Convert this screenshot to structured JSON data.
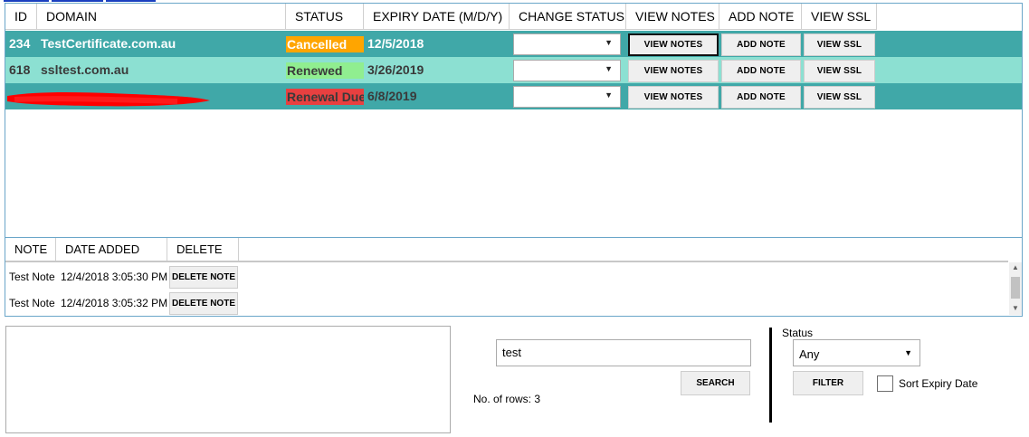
{
  "grid": {
    "columns": [
      "ID",
      "DOMAIN",
      "STATUS",
      "EXPIRY DATE (M/D/Y)",
      "CHANGE STATUS",
      "VIEW NOTES",
      "ADD NOTE",
      "VIEW SSL"
    ],
    "rows": [
      {
        "id": "234",
        "domain": "TestCertificate.com.au",
        "status": "Cancelled",
        "status_color": "#ffa500",
        "expiry": "12/5/2018",
        "row_color": "#40a8a8",
        "text_color": "#ffffff",
        "change_status": "",
        "view_notes": "VIEW NOTES",
        "add_note": "ADD NOTE",
        "view_ssl": "VIEW SSL"
      },
      {
        "id": "618",
        "domain": "ssltest.com.au",
        "status": "Renewed",
        "status_color": "#90ee90",
        "expiry": "3/26/2019",
        "row_color": "#8ce0d2",
        "text_color": "#3a3a3a",
        "change_status": "",
        "view_notes": "VIEW NOTES",
        "add_note": "ADD NOTE",
        "view_ssl": "VIEW SSL"
      },
      {
        "id": "",
        "domain": "",
        "status": "Renewal Due",
        "status_color": "#e84040",
        "expiry": "6/8/2019",
        "row_color": "#40a8a8",
        "text_color": "#3a3a3a",
        "change_status": "",
        "view_notes": "VIEW NOTES",
        "add_note": "ADD NOTE",
        "view_ssl": "VIEW SSL"
      }
    ]
  },
  "notes": {
    "columns": [
      "NOTE",
      "DATE ADDED",
      "DELETE"
    ],
    "rows": [
      {
        "note": "Test Note",
        "date": "12/4/2018 3:05:30 PM",
        "delete": "DELETE NOTE"
      },
      {
        "note": "Test Note",
        "date": "12/4/2018 3:05:32 PM",
        "delete": "DELETE NOTE"
      }
    ]
  },
  "search": {
    "value": "test",
    "button": "SEARCH",
    "row_count": "No. of rows: 3"
  },
  "filter": {
    "status_label": "Status",
    "status_value": "Any",
    "button": "FILTER",
    "sort_label": "Sort Expiry Date"
  },
  "colors": {
    "redaction": "#ff0000",
    "grid_border": "#6aa6c9"
  }
}
